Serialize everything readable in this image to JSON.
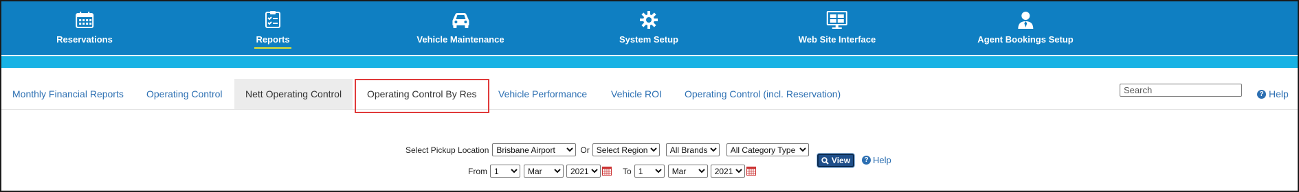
{
  "topnav": {
    "items": [
      {
        "label": "Reservations",
        "icon": "calendar-icon"
      },
      {
        "label": "Reports",
        "icon": "checklist-icon",
        "active": true
      },
      {
        "label": "Vehicle Maintenance",
        "icon": "car-icon"
      },
      {
        "label": "System Setup",
        "icon": "gear-icon"
      },
      {
        "label": "Web Site Interface",
        "icon": "monitor-icon"
      },
      {
        "label": "Agent Bookings Setup",
        "icon": "agent-icon"
      }
    ],
    "colors": {
      "bar": "#0f7fc2",
      "stripe": "#18b2e4",
      "active_underline": "#e8e32a"
    }
  },
  "tabs": [
    {
      "label": "Monthly Financial Reports"
    },
    {
      "label": "Operating Control"
    },
    {
      "label": "Nett Operating Control",
      "selected": true
    },
    {
      "label": "Operating Control By Res",
      "highlighted": true
    },
    {
      "label": "Vehicle Performance"
    },
    {
      "label": "Vehicle ROI"
    },
    {
      "label": "Operating Control (incl. Reservation)"
    }
  ],
  "search": {
    "placeholder": "Search",
    "value": ""
  },
  "help_top": {
    "label": "Help"
  },
  "form": {
    "pickup_label": "Select Pickup Location",
    "pickup_value": "Brisbane Airport",
    "or_label": "Or",
    "region_value": "Select Region",
    "brands_value": "All Brands",
    "category_value": "All Category Type",
    "from_label": "From",
    "from_day": "1",
    "from_month": "Mar",
    "from_year": "2021",
    "to_label": "To",
    "to_day": "1",
    "to_month": "Mar",
    "to_year": "2021",
    "view_label": "View",
    "help_label": "Help"
  }
}
